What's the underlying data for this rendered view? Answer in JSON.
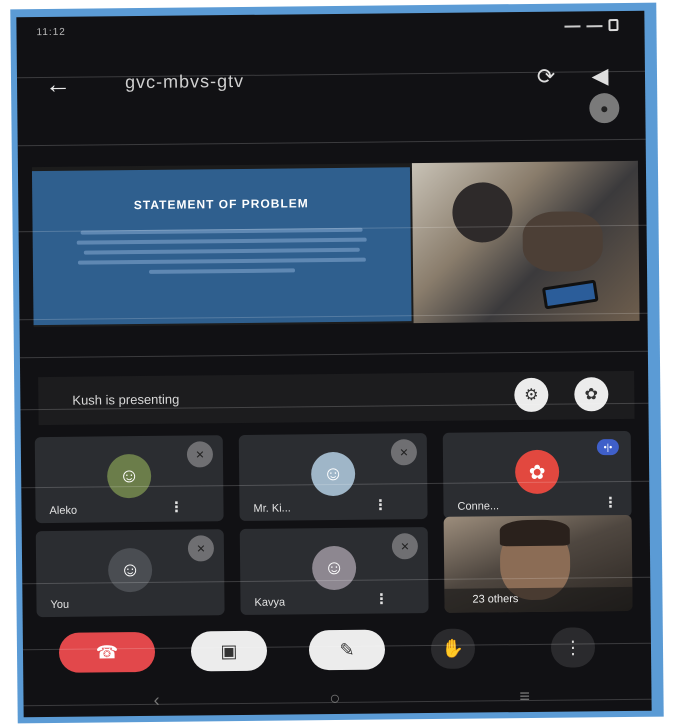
{
  "status_bar": {
    "time": "11:12"
  },
  "header": {
    "meet_code": "gvc-mbvs-gtv",
    "switch_camera_icon": "switch-camera-icon",
    "speaker_icon": "speaker-icon"
  },
  "presentation": {
    "slide_title": "STATEMENT OF PROBLEM",
    "photo_icon": "classroom-photo"
  },
  "presenting": {
    "text": "Kush is presenting"
  },
  "tiles": [
    {
      "name": "Aleko",
      "avatar_color": "#6b7d4a"
    },
    {
      "name": "Mr. Ki...",
      "avatar_color": "#9fb6c8"
    },
    {
      "name": "Conne...",
      "avatar_color": "#e2483f"
    },
    {
      "name": "You",
      "avatar_color": "#4a4d52"
    },
    {
      "name": "Kavya",
      "avatar_color": "#8d8790"
    },
    {
      "name": "23 others"
    }
  ],
  "controls": {
    "end_call_color": "#e2484b",
    "cam_color": "#ececec",
    "mic_color": "#ececec"
  },
  "navbar": {
    "back": "‹",
    "home": "○",
    "recents": "≡"
  }
}
